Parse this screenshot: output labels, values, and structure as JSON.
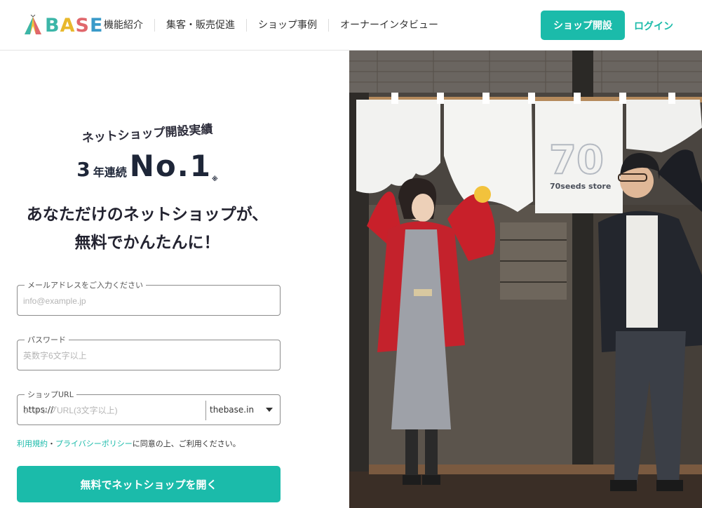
{
  "header": {
    "logo_text": "BASE",
    "nav": [
      "機能紹介",
      "集客・販売促進",
      "ショップ事例",
      "オーナーインタビュー"
    ],
    "open_shop_label": "ショップ開設",
    "login_label": "ログイン"
  },
  "hero": {
    "tagline": "ネットショップ開設実績",
    "years": "3",
    "years_unit": "年連続",
    "rank": "No.1",
    "note_mark": "※",
    "headline_line1": "あなただけのネットショップが、",
    "headline_line2": "無料でかんたんに！"
  },
  "form": {
    "email_label": "メールアドレスをご入力ください",
    "email_placeholder": "info@example.jp",
    "password_label": "パスワード",
    "password_placeholder": "英数字6文字以上",
    "url_label": "ショップURL",
    "url_prefix": "https://",
    "url_placeholder": "ショップURL(3文字以上)",
    "url_domain": "thebase.in",
    "terms_link": "利用規約",
    "separator": "・",
    "privacy_link": "プライバシーポリシー",
    "agree_text": "に同意の上、ご利用ください。",
    "submit_label": "無料でネットショップを開く"
  },
  "photo": {
    "noren_number": "70",
    "noren_text": "70seeds store"
  },
  "colors": {
    "accent": "#1bbbaa",
    "logo_b": "#3cb6a8",
    "logo_a": "#e8b82c",
    "logo_s": "#e0676c",
    "logo_e": "#3a9ac9"
  }
}
